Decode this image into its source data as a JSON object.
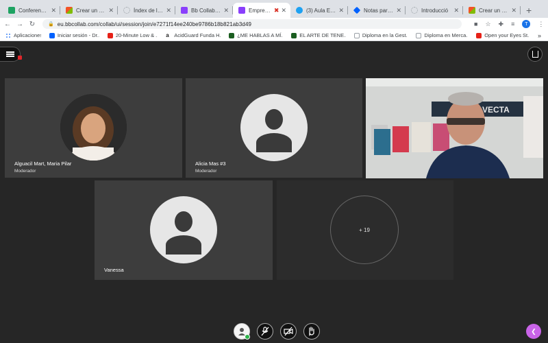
{
  "browser": {
    "tabs": [
      {
        "title": "Conference Pro",
        "icon": "green-square-icon",
        "color": "#1ea362",
        "active": false
      },
      {
        "title": "Crear un gráfi",
        "icon": "microsoft-icon",
        "color": "#f35325",
        "active": false
      },
      {
        "title": "Índex de la bib",
        "icon": "loading-icon",
        "color": "#9aa0a6",
        "active": false
      },
      {
        "title": "Bb Collaborat",
        "icon": "blackboard-icon",
        "color": "#8a3ffc",
        "active": false
      },
      {
        "title": "Emprendiz",
        "icon": "blackboard-icon",
        "color": "#8a3ffc",
        "active": true
      },
      {
        "title": "(3) Aula Empr",
        "icon": "twitter-icon",
        "color": "#1da1f2",
        "active": false
      },
      {
        "title": "Notas para añ",
        "icon": "dropbox-icon",
        "color": "#0061fe",
        "active": false
      },
      {
        "title": "Introducció",
        "icon": "loading-icon",
        "color": "#9aa0a6",
        "active": false
      },
      {
        "title": "Crear un gráfi",
        "icon": "microsoft-icon",
        "color": "#f35325",
        "active": false
      }
    ],
    "new_tab": "+",
    "url": "eu.bbcollab.com/collab/ui/session/join/e7271f14ee240be9786b18b821ab3d49",
    "profile_initial": "T",
    "bookmarks": [
      {
        "label": "Aplicaciones",
        "color": "#4285f4"
      },
      {
        "label": "Iniciar sesión - Dr...",
        "color": "#0061fe"
      },
      {
        "label": "20-Minute Low & ...",
        "color": "#e62117"
      },
      {
        "label": "AcidGuard Funda H...",
        "color": "#222222"
      },
      {
        "label": "¿ME HABLAS A MÍ...",
        "color": "#1b5e20"
      },
      {
        "label": "EL ARTE DE TENE...",
        "color": "#1b5e20"
      },
      {
        "label": "Diploma en la Gest...",
        "color": "#9aa0a6"
      },
      {
        "label": "Diploma en Merca...",
        "color": "#9aa0a6"
      },
      {
        "label": "Open your Eyes St...",
        "color": "#e62117"
      }
    ],
    "bookmarks_more": "»"
  },
  "session": {
    "participants": [
      {
        "name": "Alguacil Mart, Maria Pilar",
        "role": "Moderador",
        "avatar": "photo"
      },
      {
        "name": "Alicia Mas #3",
        "role": "Moderador",
        "avatar": "default-user-icon"
      },
      {
        "name": "",
        "role": "",
        "avatar": "video"
      },
      {
        "name": "Vanessa",
        "role": "",
        "avatar": "default-user-icon"
      }
    ],
    "overflow_count": "+ 19",
    "video_sign_text": "VECTA"
  },
  "controls": {
    "status": "available",
    "accent": "#c964e8"
  }
}
